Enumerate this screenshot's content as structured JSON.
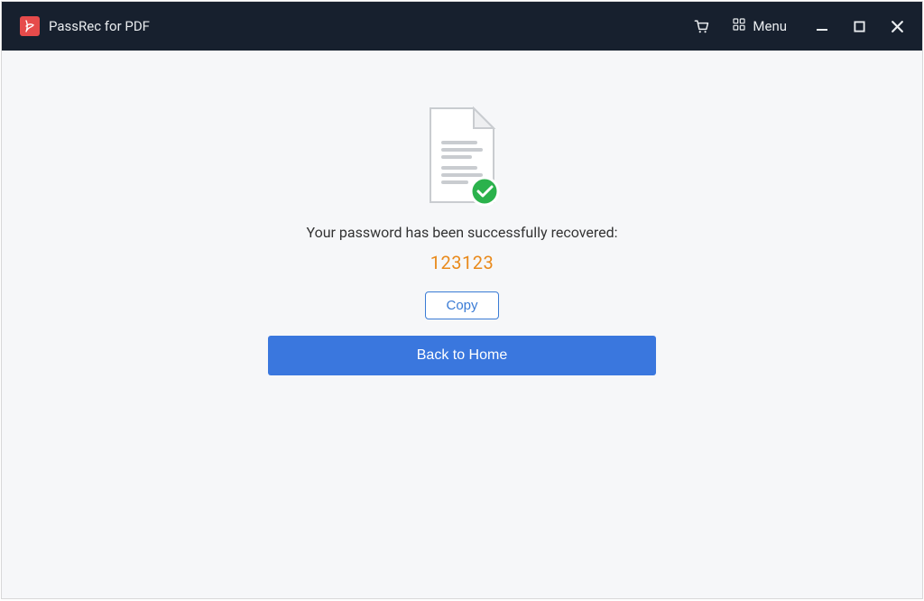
{
  "header": {
    "app_title": "PassRec for PDF",
    "menu_label": "Menu"
  },
  "main": {
    "message": "Your password has been successfully recovered:",
    "password": "123123",
    "copy_label": "Copy",
    "home_label": "Back to Home"
  }
}
